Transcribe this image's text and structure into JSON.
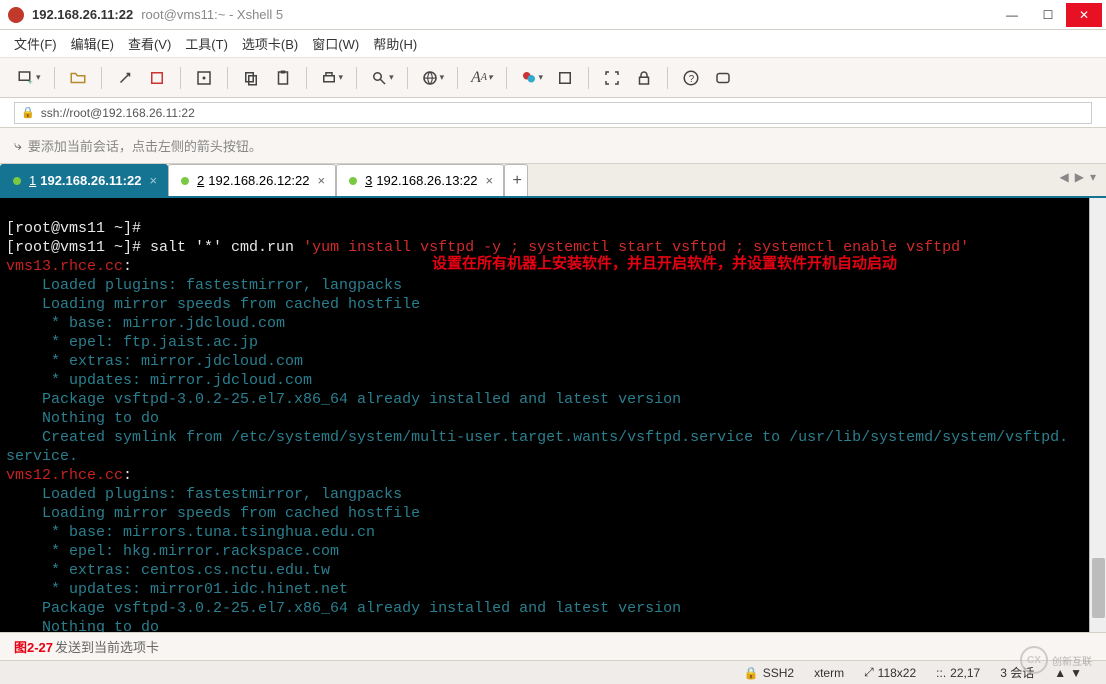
{
  "title": {
    "app": "192.168.26.11:22",
    "detail": "root@vms11:~ - Xshell 5"
  },
  "menu": {
    "file": "文件(F)",
    "edit": "编辑(E)",
    "view": "查看(V)",
    "tools": "工具(T)",
    "tabs": "选项卡(B)",
    "window": "窗口(W)",
    "help": "帮助(H)"
  },
  "addr": {
    "url": "ssh://root@192.168.26.11:22"
  },
  "info": {
    "msg": "要添加当前会话，点击左侧的箭头按钮。"
  },
  "tabs": [
    {
      "num": "1",
      "label": "192.168.26.11:22",
      "active": true
    },
    {
      "num": "2",
      "label": "192.168.26.12:22",
      "active": false
    },
    {
      "num": "3",
      "label": "192.168.26.13:22",
      "active": false
    }
  ],
  "term": {
    "p1": "[root@vms11 ~]#",
    "p2": "[root@vms11 ~]# ",
    "cmd_head": "salt '*' cmd.run ",
    "cmd_str": "'yum install vsftpd -y ; systemctl start vsftpd ; systemctl enable vsftpd'",
    "annot": "设置在所有机器上安装软件，并且开启软件，并设置软件开机自动启动",
    "host1": "vms13.rhce.cc",
    "l_plugins": "    Loaded plugins: fastestmirror, langpacks",
    "l_speeds": "    Loading mirror speeds from cached hostfile",
    "m1_base": "     * base: mirror.jdcloud.com",
    "m1_epel": "     * epel: ftp.jaist.ac.jp",
    "m1_extras": "     * extras: mirror.jdcloud.com",
    "m1_updates": "     * updates: mirror.jdcloud.com",
    "pkg": "    Package vsftpd-3.0.2-25.el7.x86_64 already installed and latest version",
    "nothing": "    Nothing to do",
    "symlink1": "    Created symlink from /etc/systemd/system/multi-user.target.wants/vsftpd.service to /usr/lib/systemd/system/vsftpd.",
    "symlink2": "service.",
    "host2": "vms12.rhce.cc",
    "m2_base": "     * base: mirrors.tuna.tsinghua.edu.cn",
    "m2_epel": "     * epel: hkg.mirror.rackspace.com",
    "m2_extras": "     * extras: centos.cs.nctu.edu.tw",
    "m2_updates": "     * updates: mirror01.idc.hinet.net"
  },
  "footer1": {
    "fig": "图2-27",
    "tail": "发送到当前选项卡"
  },
  "status": {
    "proto": "SSH2",
    "term": "xterm",
    "size": "118x22",
    "cursor": "22,17",
    "sessions": "3 会话",
    "up": "▲",
    "down": "▼"
  }
}
